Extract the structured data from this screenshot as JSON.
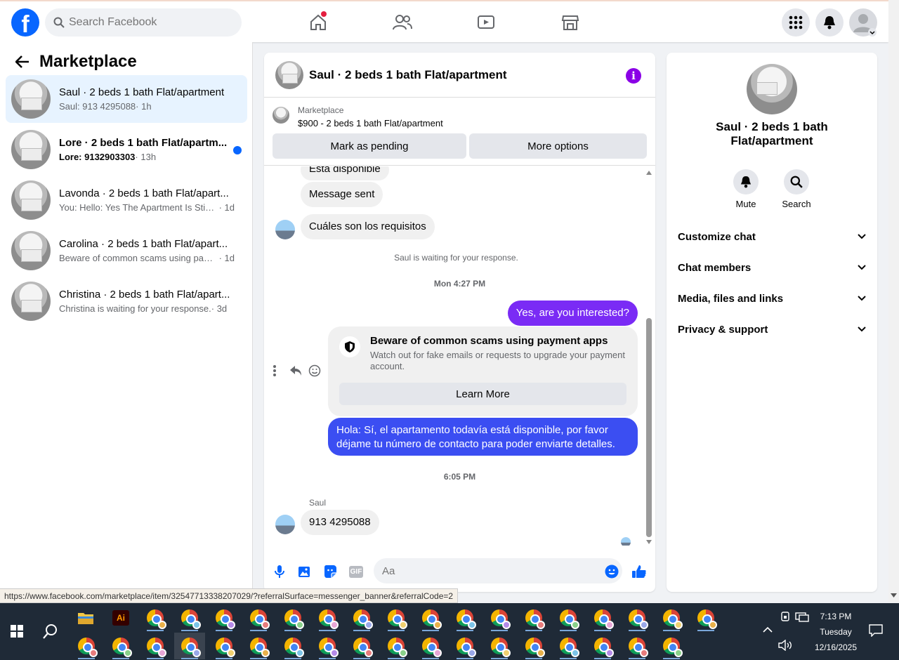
{
  "topbar": {
    "logo": "f",
    "search_placeholder": "Search Facebook",
    "nav_icons": [
      "home-icon",
      "friends-icon",
      "watch-icon",
      "marketplace-icon"
    ],
    "right_icons": [
      "menu-grid-icon",
      "notifications-icon",
      "account-icon"
    ]
  },
  "sidebar": {
    "title": "Marketplace",
    "conversations": [
      {
        "name": "Saul · 2 beds 1 bath Flat/apartment",
        "snippet": "Saul: 913 4295088",
        "time": "· 1h",
        "active": true,
        "unread": false
      },
      {
        "name": "Lore · 2 beds 1 bath Flat/apartm...",
        "snippet": "Lore: 9132903303",
        "time": "· 13h",
        "active": false,
        "unread": true
      },
      {
        "name": "Lavonda · 2 beds 1 bath Flat/apart...",
        "snippet": "You: Hello: Yes The Apartment Is Still ...",
        "time": "· 1d",
        "active": false,
        "unread": false
      },
      {
        "name": "Carolina · 2 beds 1 bath Flat/apart...",
        "snippet": "Beware of common scams using pay...",
        "time": "· 1d",
        "active": false,
        "unread": false
      },
      {
        "name": "Christina · 2 beds 1 bath Flat/apart...",
        "snippet": "Christina is waiting for your response.",
        "time": "· 3d",
        "active": false,
        "unread": false
      }
    ]
  },
  "chat": {
    "title": "Saul · 2 beds 1 bath Flat/apartment",
    "banner": {
      "label": "Marketplace",
      "listing": "$900 - 2 beds 1 bath Flat/apartment",
      "btn_pending": "Mark as pending",
      "btn_more": "More options"
    },
    "messages": {
      "m1": "Está disponible",
      "m2": "Message sent",
      "m3": "Cuáles son los requisitos",
      "waiting": "Saul is waiting for your response.",
      "ts1": "Mon 4:27 PM",
      "m4": "Yes, are you interested?",
      "scam_title": "Beware of common scams using payment apps",
      "scam_desc": "Watch out for fake emails or requests to upgrade your payment account.",
      "scam_btn": "Learn More",
      "m5": "Hola: Sí, el apartamento todavía está disponible, por favor déjame tu número de contacto para poder enviarte detalles.",
      "ts2": "6:05 PM",
      "sender": "Saul",
      "m6": "913 4295088"
    },
    "composer": {
      "placeholder": "Aa",
      "icons": [
        "microphone-icon",
        "photo-icon",
        "sticker-icon",
        "gif-icon",
        "emoji-icon",
        "like-icon"
      ],
      "gif_label": "GIF"
    }
  },
  "details": {
    "name": "Saul · 2 beds 1 bath Flat/apartment",
    "mute": "Mute",
    "search": "Search",
    "sections": [
      "Customize chat",
      "Chat members",
      "Media, files and links",
      "Privacy & support"
    ]
  },
  "status_url": "https://www.facebook.com/marketplace/item/32547713338207029/?referralSurface=messenger_banner&referralCode=2",
  "taskbar": {
    "time": "7:13 PM",
    "day": "Tuesday",
    "date": "12/16/2025",
    "adobe_label": "Ai"
  },
  "colors": {
    "brand": "#0866ff",
    "outgoing": "#7a2bf5",
    "outgoing_alt": "#3b4ef2",
    "info": "#8a00e6"
  }
}
